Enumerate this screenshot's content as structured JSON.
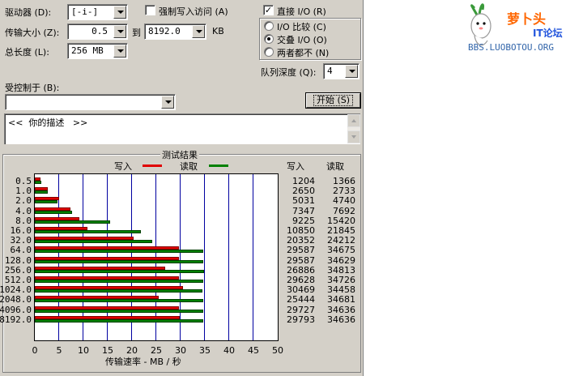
{
  "controls": {
    "drive_label": "驱动器 (D):",
    "drive_value": "[-i-]",
    "transfer_label": "传输大小 (Z):",
    "transfer_from": "0.5",
    "to_label": "到",
    "transfer_to": "8192.0",
    "unit_kb": "KB",
    "total_label": "总长度 (L):",
    "total_value": "256 MB",
    "force_write_label": "强制写入访问 (A)",
    "direct_io_label": "直接 I/O (R)",
    "io_compare_label": "I/O 比较 (C)",
    "overlap_io_label": "交叠 I/O (O)",
    "neither_label": "两者都不 (N)",
    "queue_label": "队列深度 (Q):",
    "queue_value": "4",
    "controlled_label": "受控制于 (B):",
    "controlled_value": "",
    "start_button": "开始 (S)",
    "description_text": "<<  你的描述   >>"
  },
  "results": {
    "title": "测试结果",
    "legend_write": "写入",
    "legend_read": "读取",
    "col_write": "写入",
    "col_read": "读取",
    "xlabel": "传输速率 - MB / 秒"
  },
  "colors": {
    "write": "#e00000",
    "read": "#008000",
    "grid": "#0000a0"
  },
  "watermark": {
    "line1": "萝卜头",
    "line2": "IT论坛",
    "line3": "BBS.LUOBOTOU.ORG"
  },
  "chart_data": {
    "type": "bar",
    "orientation": "horizontal",
    "categories": [
      "0.5",
      "1.0",
      "2.0",
      "4.0",
      "8.0",
      "16.0",
      "32.0",
      "64.0",
      "128.0",
      "256.0",
      "512.0",
      "1024.0",
      "2048.0",
      "4096.0",
      "8192.0"
    ],
    "series": [
      {
        "name": "写入",
        "values": [
          1204,
          2650,
          5031,
          7347,
          9225,
          10850,
          20352,
          29587,
          29587,
          26886,
          29628,
          30469,
          25444,
          29727,
          29793
        ]
      },
      {
        "name": "读取",
        "values": [
          1366,
          2733,
          4740,
          7692,
          15420,
          21845,
          24212,
          34675,
          34629,
          34813,
          34726,
          34458,
          34681,
          34636,
          34636
        ]
      }
    ],
    "xlim": [
      0,
      50
    ],
    "xticks": [
      "0",
      "5",
      "10",
      "15",
      "20",
      "25",
      "30",
      "35",
      "40",
      "45",
      "50"
    ],
    "grid": true,
    "legend": "top"
  }
}
